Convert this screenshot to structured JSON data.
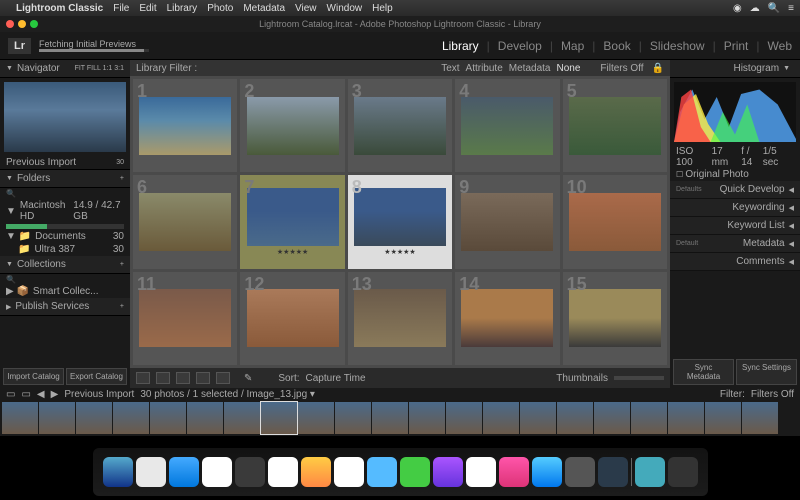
{
  "menubar": {
    "app": "Lightroom Classic",
    "items": [
      "File",
      "Edit",
      "Library",
      "Photo",
      "Metadata",
      "View",
      "Window",
      "Help"
    ]
  },
  "window": {
    "title": "Lightroom Catalog.lrcat - Adobe Photoshop Lightroom Classic - Library"
  },
  "topbar": {
    "logo": "Lr",
    "status": "Fetching Initial Previews"
  },
  "modules": {
    "items": [
      "Library",
      "Develop",
      "Map",
      "Book",
      "Slideshow",
      "Print",
      "Web"
    ],
    "active": "Library"
  },
  "left": {
    "navigator": {
      "title": "Navigator",
      "modes": "FIT  FILL  1:1  3:1"
    },
    "previousImport": {
      "label": "Previous Import",
      "count": "30"
    },
    "folders": {
      "title": "Folders",
      "disk": {
        "name": "Macintosh HD",
        "usage": "14.9 / 42.7 GB"
      },
      "items": [
        {
          "name": "Documents",
          "count": "30"
        },
        {
          "name": "Ultra 387",
          "count": "30"
        }
      ]
    },
    "collections": {
      "title": "Collections",
      "items": [
        {
          "name": "Smart Collec..."
        }
      ]
    },
    "publish": {
      "title": "Publish Services"
    },
    "buttons": {
      "import": "Import Catalog",
      "export": "Export Catalog"
    }
  },
  "filter": {
    "label": "Library Filter :",
    "tabs": [
      "Text",
      "Attribute",
      "Metadata",
      "None"
    ],
    "off": "Filters Off"
  },
  "grid": {
    "selected": 8,
    "stars": "★★★★★"
  },
  "toolbar": {
    "sort": "Sort:",
    "sortval": "Capture Time",
    "thumbs": "Thumbnails"
  },
  "right": {
    "histogram": {
      "title": "Histogram",
      "iso": "ISO 100",
      "focal": "17 mm",
      "aperture": "f / 14",
      "shutter": "1/5 sec",
      "original": "Original Photo"
    },
    "panels": [
      {
        "pre": "Defaults",
        "label": "Quick Develop"
      },
      {
        "label": "Keywording"
      },
      {
        "label": "Keyword List"
      },
      {
        "pre": "Default",
        "label": "Metadata"
      },
      {
        "label": "Comments"
      }
    ],
    "sync": {
      "meta": "Sync Metadata",
      "settings": "Sync Settings"
    }
  },
  "strip": {
    "crumb": "Previous Import",
    "info": "30 photos / 1 selected / Image_13.jpg ▾",
    "filter": "Filter:",
    "off": "Filters Off"
  }
}
